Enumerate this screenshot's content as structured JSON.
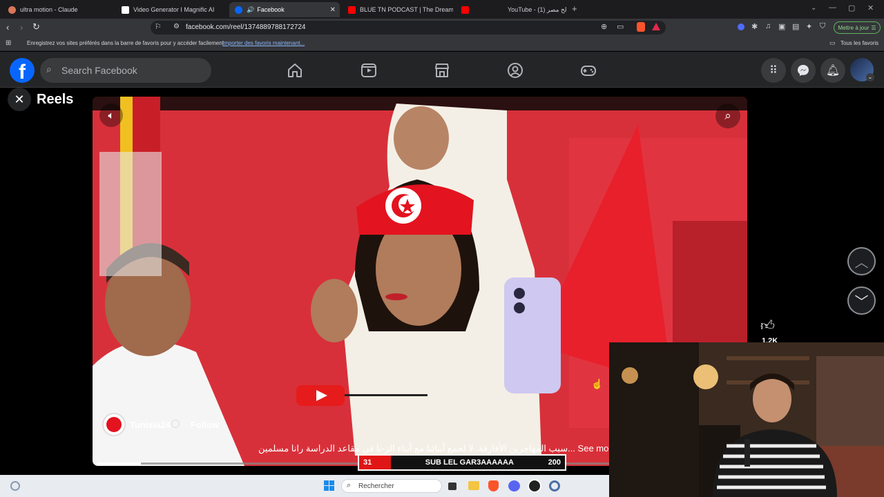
{
  "browser": {
    "tabs": [
      {
        "label": "ultra motion - Claude",
        "active": false
      },
      {
        "label": "Video Generator I Magnific AI",
        "active": false
      },
      {
        "label": "Facebook",
        "active": true
      },
      {
        "label": "BLUE TN PODCAST | The Dreamer",
        "active": false
      },
      {
        "label": "YouTube - صالح مصر (1)",
        "active": false
      }
    ],
    "new_tab_label": "+",
    "url": "facebook.com/reel/1374889788172724",
    "update_button": "Mettre à jour",
    "bookmarks_prompt": "Enregistrez vos sites préférés dans la barre de favoris pour y accéder facilement.",
    "bookmarks_import": "Importer des favoris maintenant...",
    "all_bookmarks": "Tous les favoris"
  },
  "facebook": {
    "logo": "f",
    "search_placeholder": "Search Facebook",
    "nav_icons": [
      "home-icon",
      "video-icon",
      "marketplace-icon",
      "groups-icon",
      "gaming-icon"
    ],
    "reels_title": "Reels"
  },
  "reel": {
    "channel": "Tunisia24",
    "follow": "· Follow",
    "caption": "سبب المهاجرين الأفارقة..لا لجمع أبنائنا مع أبناء الز-نا في مقاعد الدراسة رانا مسلمين... See more",
    "likes": "1.2K"
  },
  "overlay": {
    "left_count": "31",
    "label": "SUB LEL GAR3AAAAAA",
    "right_count": "200"
  },
  "taskbar": {
    "search_placeholder": "Rechercher"
  },
  "colors": {
    "facebook_blue": "#0866ff",
    "nav_bg": "#242526",
    "video_red": "#d9323a",
    "subbar_red": "#e01616"
  }
}
